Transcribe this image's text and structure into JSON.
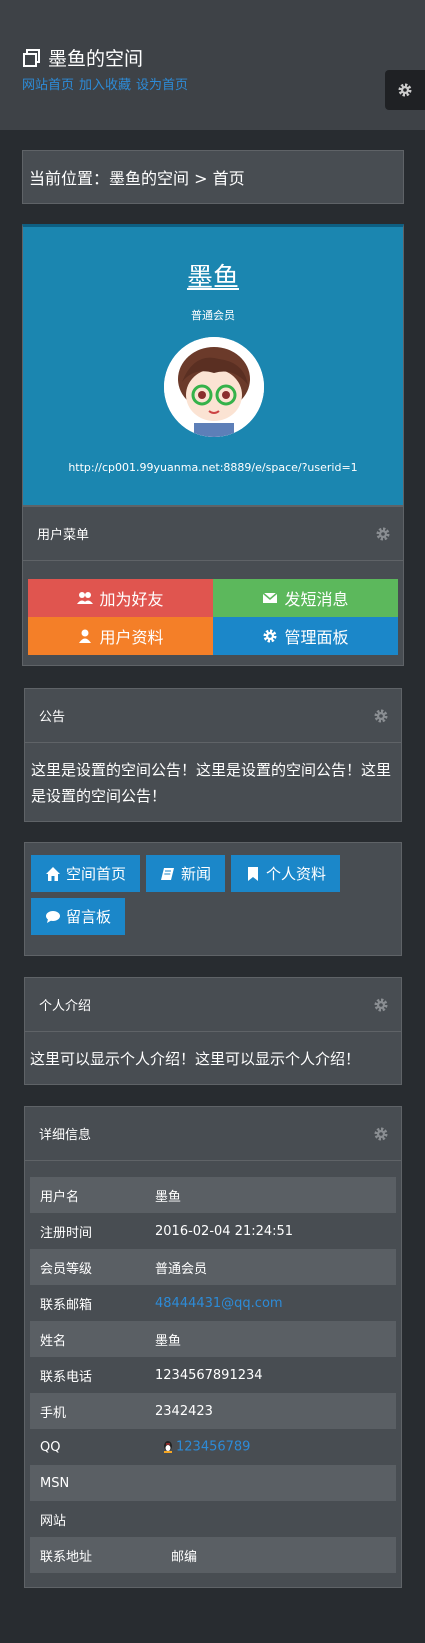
{
  "header": {
    "title": "墨鱼的空间",
    "links": [
      "网站首页",
      "加入收藏",
      "设为首页"
    ]
  },
  "breadcrumb": "当前位置：墨鱼的空间 > 首页",
  "profile": {
    "name": "墨鱼",
    "level": "普通会员",
    "url": "http://cp001.99yuanma.net:8889/e/space/?userid=1"
  },
  "user_menu": {
    "title": "用户菜单",
    "items": [
      {
        "label": "加为好友",
        "color": "#e0554f",
        "icon": "users-icon"
      },
      {
        "label": "发短消息",
        "color": "#5cb85c",
        "icon": "envelope-icon"
      },
      {
        "label": "用户资料",
        "color": "#f47f28",
        "icon": "user-icon"
      },
      {
        "label": "管理面板",
        "color": "#1b87c9",
        "icon": "gear-icon"
      }
    ]
  },
  "notice": {
    "title": "公告",
    "text": "这里是设置的空间公告！这里是设置的空间公告！这里是设置的空间公告！"
  },
  "nav": [
    {
      "label": "空间首页",
      "icon": "home-icon"
    },
    {
      "label": "新闻",
      "icon": "book-icon"
    },
    {
      "label": "个人资料",
      "icon": "bookmark-icon"
    },
    {
      "label": "留言板",
      "icon": "comment-icon"
    }
  ],
  "intro": {
    "title": "个人介绍",
    "text": "这里可以显示个人介绍！这里可以显示个人介绍！"
  },
  "detail": {
    "title": "详细信息",
    "rows": [
      {
        "key": "用户名",
        "value": "墨鱼"
      },
      {
        "key": "注册时间",
        "value": "2016-02-04 21:24:51"
      },
      {
        "key": "会员等级",
        "value": "普通会员"
      },
      {
        "key": "联系邮箱",
        "value": "48444431@qq.com"
      },
      {
        "key": "姓名",
        "value": "墨鱼"
      },
      {
        "key": "联系电话",
        "value": "1234567891234"
      },
      {
        "key": "手机",
        "value": "2342423"
      },
      {
        "key": "QQ",
        "value": "123456789"
      },
      {
        "key": "MSN",
        "value": ""
      },
      {
        "key": "网站",
        "value": ""
      },
      {
        "key": "联系地址",
        "value": "",
        "extra_label": "邮编"
      }
    ]
  }
}
